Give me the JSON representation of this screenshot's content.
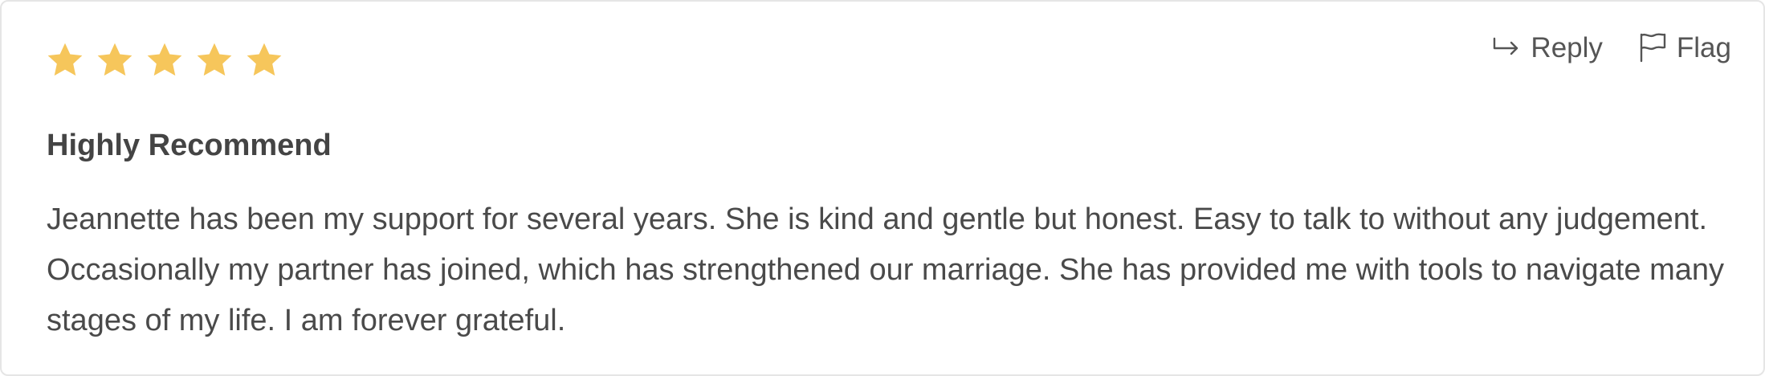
{
  "review": {
    "rating": 5,
    "rating_max": 5,
    "star_color": "#f6c65b",
    "title": "Highly Recommend",
    "body": "Jeannette has been my support for several years. She is kind and gentle but honest. Easy to talk to without any judgement. Occasionally my partner has joined, which has strengthened our marriage. She has provided me with tools to navigate many stages of my life. I am forever grateful."
  },
  "actions": {
    "reply_label": "Reply",
    "reply_icon": "reply-arrow-icon",
    "flag_label": "Flag",
    "flag_icon": "flag-icon"
  }
}
